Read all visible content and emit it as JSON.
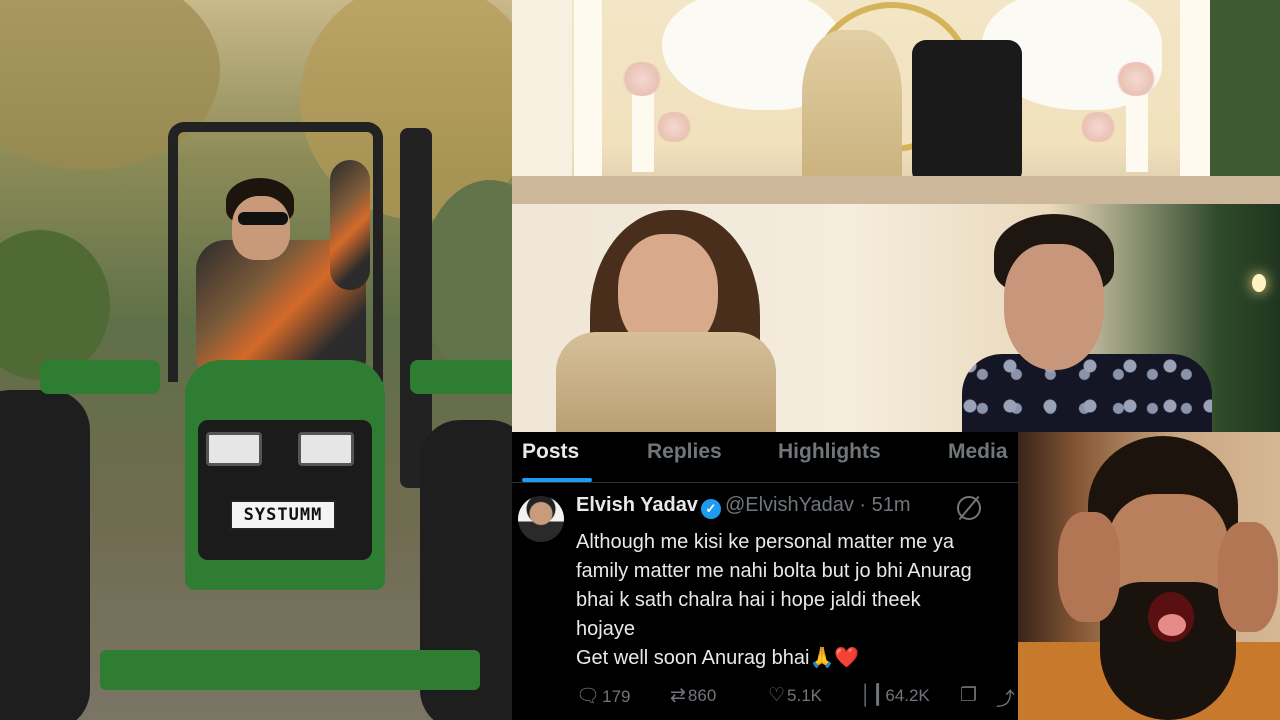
{
  "tractor_photo": {
    "number_plate": "SYSTUMM"
  },
  "tweet": {
    "tabs": [
      "Posts",
      "Replies",
      "Highlights",
      "Media"
    ],
    "active_tab": "Posts",
    "display_name": "Elvish Yadav",
    "verified_icon": "✓",
    "handle": "@ElvishYadav",
    "time": "· 51m",
    "body_lines": [
      "Although me kisi ke personal matter me ya",
      "family matter me nahi bolta but jo bhi Anurag",
      "bhai k sath chalra hai i hope jaldi theek",
      "hojaye",
      "Get well soon Anurag bhai🙏❤️"
    ],
    "actions": {
      "replies": "179",
      "reposts": "860",
      "likes": "5.1K",
      "views": "64.2K"
    },
    "icons": {
      "reply": "💬",
      "repost": "⟲",
      "like": "♡",
      "views": "📊",
      "bookmark": "🔖",
      "share": "⇪"
    },
    "colors": {
      "accent": "#1d9bf0",
      "background": "#000000",
      "text": "#e7e9ea",
      "muted": "#71767b"
    }
  }
}
